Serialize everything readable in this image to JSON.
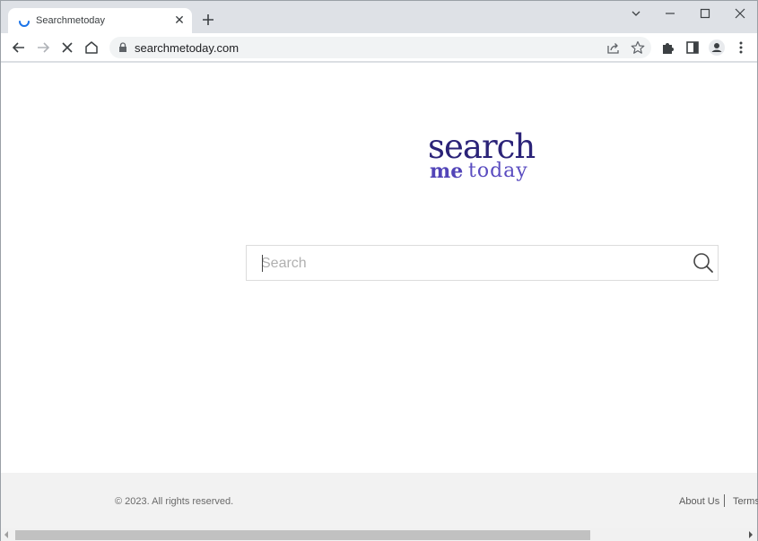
{
  "browser": {
    "tab": {
      "title": "Searchmetoday",
      "close_icon": "close-icon",
      "loading_icon": "spinner-icon"
    },
    "new_tab_icon": "plus-icon",
    "window_controls": [
      "chevron-down-icon",
      "minimize-icon",
      "maximize-icon",
      "close-icon"
    ],
    "nav": [
      "back-arrow-icon",
      "forward-arrow-icon",
      "stop-icon",
      "home-icon"
    ],
    "address": {
      "url": "searchmetoday.com",
      "lock_icon": "lock-icon"
    },
    "omnibox_actions": [
      "share-icon",
      "star-icon"
    ],
    "toolbar_actions": [
      "extensions-puzzle-icon",
      "side-panel-icon",
      "profile-avatar-icon",
      "kebab-menu-icon"
    ]
  },
  "page": {
    "logo": {
      "line1": "search",
      "line2_bold": "me",
      "line2_regular": "today"
    },
    "search": {
      "placeholder": "Search",
      "value": ""
    },
    "footer": {
      "copyright": "© 2023. All rights reserved.",
      "links": [
        "About Us",
        "Terms"
      ]
    }
  },
  "colors": {
    "logo_dark": "#2b2378",
    "logo_accent": "#5244b8",
    "spinner": "#1a73e8"
  }
}
